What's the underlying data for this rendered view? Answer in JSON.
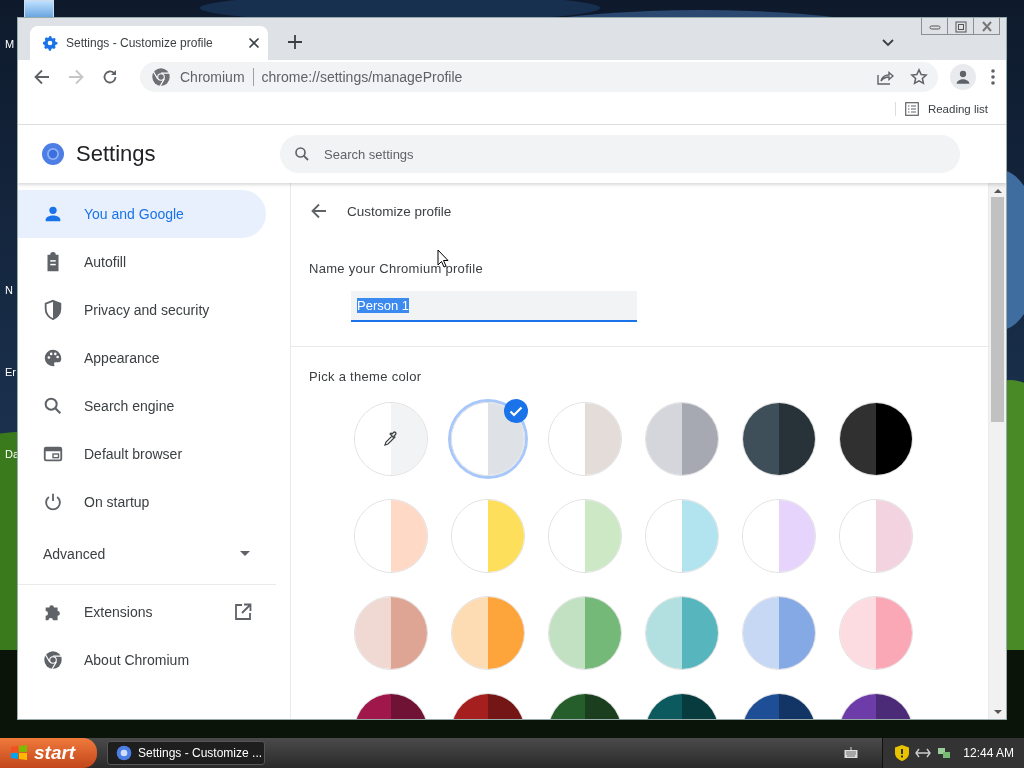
{
  "desktop": {
    "icon_labels": [
      "M",
      "N",
      "Er",
      "Da"
    ]
  },
  "browser": {
    "tabs": [
      {
        "title": "Settings - Customize profile",
        "selected": true
      }
    ],
    "address_bar": {
      "site": "Chromium",
      "url": "chrome://settings/manageProfile"
    },
    "reading_list": "Reading list"
  },
  "settings": {
    "title": "Settings",
    "search_placeholder": "Search settings"
  },
  "sidebar": {
    "items": [
      {
        "label": "You and Google",
        "kind": "person",
        "selected": true
      },
      {
        "label": "Autofill",
        "kind": "clipboard",
        "selected": false
      },
      {
        "label": "Privacy and security",
        "kind": "shield",
        "selected": false
      },
      {
        "label": "Appearance",
        "kind": "palette",
        "selected": false
      },
      {
        "label": "Search engine",
        "kind": "search",
        "selected": false
      },
      {
        "label": "Default browser",
        "kind": "browser",
        "selected": false
      },
      {
        "label": "On startup",
        "kind": "power",
        "selected": false
      }
    ],
    "advanced": {
      "label": "Advanced",
      "expanded": false
    },
    "links": [
      {
        "label": "Extensions",
        "kind": "puzzle",
        "external": true
      },
      {
        "label": "About Chromium",
        "kind": "chromium",
        "external": false
      }
    ]
  },
  "page": {
    "title": "Customize profile",
    "name_label": "Name your Chromium profile",
    "name_value": "Person 1",
    "name_selected": true,
    "theme_label": "Pick a theme color",
    "swatches": [
      {
        "kind": "picker",
        "halves": [
          {
            "color": "#ffffff"
          },
          {
            "color": "#f1f3f4"
          }
        ],
        "selected": false
      },
      {
        "kind": "color",
        "halves": [
          {
            "color": "#ffffff"
          },
          {
            "color": "#dee1e6"
          }
        ],
        "selected": true
      },
      {
        "kind": "color",
        "halves": [
          {
            "color": "#ffffff"
          },
          {
            "color": "#e3dcd9"
          }
        ],
        "selected": false
      },
      {
        "kind": "color",
        "halves": [
          {
            "color": "#d4d6dc"
          },
          {
            "color": "#a6a9b2"
          }
        ],
        "selected": false
      },
      {
        "kind": "color",
        "halves": [
          {
            "color": "#3f4f5a"
          },
          {
            "color": "#283239"
          }
        ],
        "selected": false
      },
      {
        "kind": "color",
        "halves": [
          {
            "color": "#303030"
          },
          {
            "color": "#000000"
          }
        ],
        "selected": false
      },
      {
        "kind": "color",
        "halves": [
          {
            "color": "#ffffff"
          },
          {
            "color": "#fdd9c6"
          }
        ],
        "selected": false
      },
      {
        "kind": "color",
        "halves": [
          {
            "color": "#ffffff"
          },
          {
            "color": "#fedf5c"
          }
        ],
        "selected": false
      },
      {
        "kind": "color",
        "halves": [
          {
            "color": "#ffffff"
          },
          {
            "color": "#cce8c4"
          }
        ],
        "selected": false
      },
      {
        "kind": "color",
        "halves": [
          {
            "color": "#ffffff"
          },
          {
            "color": "#b2e4ef"
          }
        ],
        "selected": false
      },
      {
        "kind": "color",
        "halves": [
          {
            "color": "#ffffff"
          },
          {
            "color": "#e6d4fc"
          }
        ],
        "selected": false
      },
      {
        "kind": "color",
        "halves": [
          {
            "color": "#ffffff"
          },
          {
            "color": "#f3d3df"
          }
        ],
        "selected": false
      },
      {
        "kind": "color",
        "halves": [
          {
            "color": "#f1d9d3"
          },
          {
            "color": "#dfa594"
          }
        ],
        "selected": false
      },
      {
        "kind": "color",
        "halves": [
          {
            "color": "#fddcb4"
          },
          {
            "color": "#fda53b"
          }
        ],
        "selected": false
      },
      {
        "kind": "color",
        "halves": [
          {
            "color": "#c2e1c2"
          },
          {
            "color": "#75b979"
          }
        ],
        "selected": false
      },
      {
        "kind": "color",
        "halves": [
          {
            "color": "#b2e0e1"
          },
          {
            "color": "#57b6bd"
          }
        ],
        "selected": false
      },
      {
        "kind": "color",
        "halves": [
          {
            "color": "#c7d8f5"
          },
          {
            "color": "#85a9e5"
          }
        ],
        "selected": false
      },
      {
        "kind": "color",
        "halves": [
          {
            "color": "#fcdbe1"
          },
          {
            "color": "#fba8b6"
          }
        ],
        "selected": false
      },
      {
        "kind": "color",
        "halves": [
          {
            "color": "#a0174c"
          },
          {
            "color": "#6f1233"
          }
        ],
        "selected": false
      },
      {
        "kind": "color",
        "halves": [
          {
            "color": "#a61f1f"
          },
          {
            "color": "#741616"
          }
        ],
        "selected": false
      },
      {
        "kind": "color",
        "halves": [
          {
            "color": "#255e2a"
          },
          {
            "color": "#1b3f1e"
          }
        ],
        "selected": false
      },
      {
        "kind": "color",
        "halves": [
          {
            "color": "#0d5a5e"
          },
          {
            "color": "#083b3e"
          }
        ],
        "selected": false
      },
      {
        "kind": "color",
        "halves": [
          {
            "color": "#1e4f96"
          },
          {
            "color": "#123565"
          }
        ],
        "selected": false
      },
      {
        "kind": "color",
        "halves": [
          {
            "color": "#6d3ca8"
          },
          {
            "color": "#4b2a78"
          }
        ],
        "selected": false
      }
    ]
  },
  "taskbar": {
    "start": "start",
    "tasks": [
      {
        "title": "Settings - Customize ...",
        "selected": false
      }
    ],
    "clock": "12:44 AM"
  }
}
